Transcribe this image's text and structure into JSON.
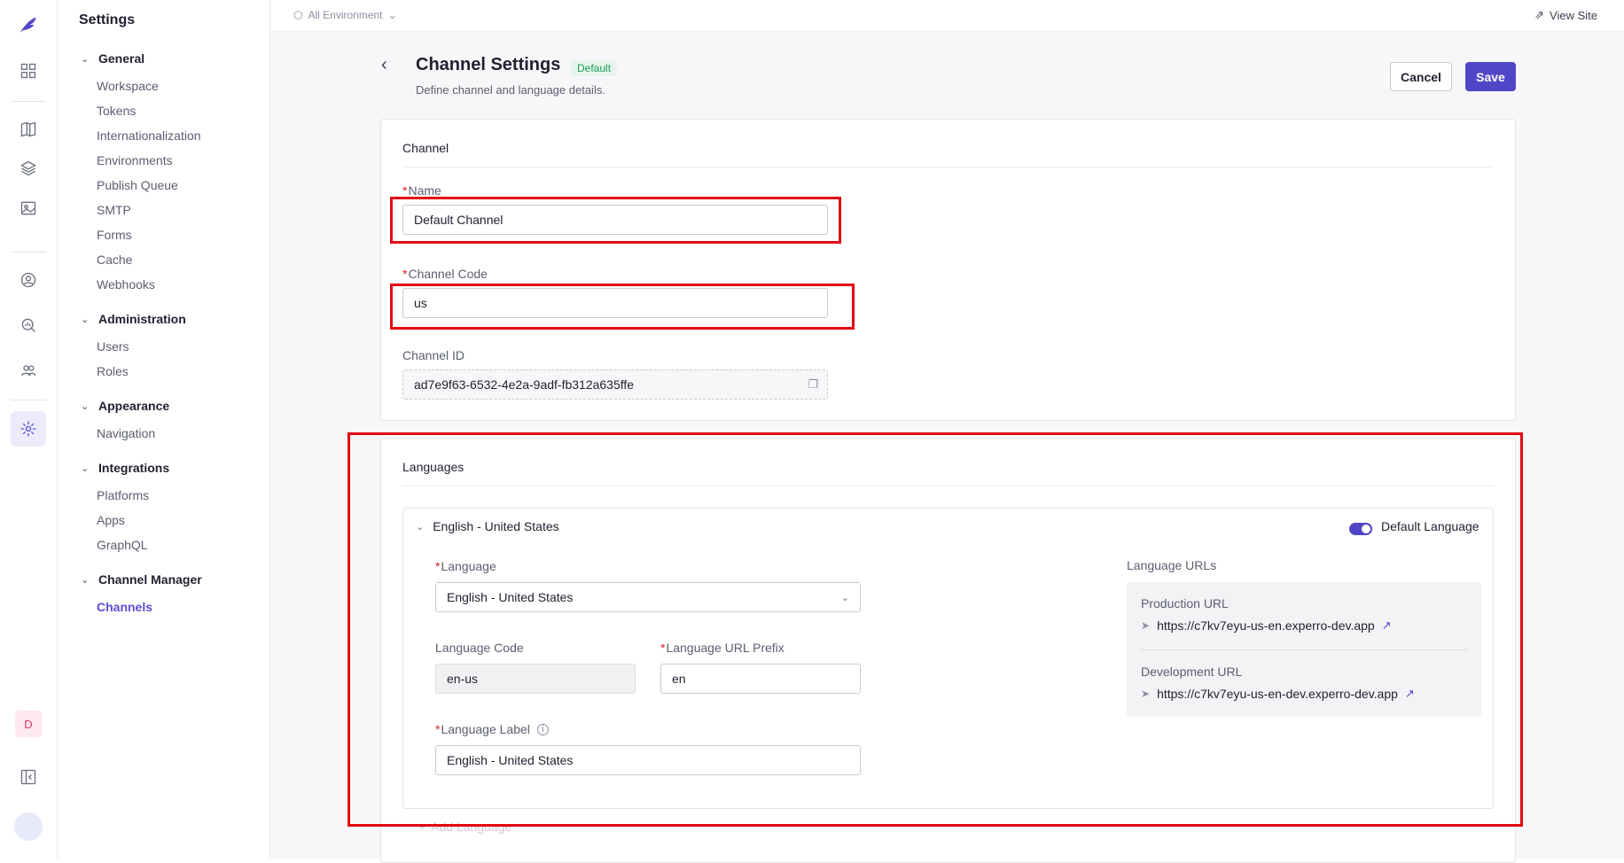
{
  "topbar": {
    "environment": "All Environment",
    "view_site": "View Site"
  },
  "settings_nav": {
    "title": "Settings",
    "groups": [
      {
        "label": "General",
        "items": [
          "Workspace",
          "Tokens",
          "Internationalization",
          "Environments",
          "Publish Queue",
          "SMTP",
          "Forms",
          "Cache",
          "Webhooks"
        ]
      },
      {
        "label": "Administration",
        "items": [
          "Users",
          "Roles"
        ]
      },
      {
        "label": "Appearance",
        "items": [
          "Navigation"
        ]
      },
      {
        "label": "Integrations",
        "items": [
          "Platforms",
          "Apps",
          "GraphQL"
        ]
      },
      {
        "label": "Channel Manager",
        "items": [
          "Channels"
        ]
      }
    ],
    "active_item": "Channels"
  },
  "rail": {
    "user_initial": "D",
    "icons": [
      "logo-icon",
      "dashboard-icon",
      "book-icon",
      "layers-icon",
      "image-icon",
      "user-circle-icon",
      "analytics-icon",
      "users-icon",
      "settings-icon",
      "collapse-icon"
    ]
  },
  "header": {
    "title": "Channel Settings",
    "badge": "Default",
    "subtitle": "Define channel and language details.",
    "cancel_label": "Cancel",
    "save_label": "Save"
  },
  "channel": {
    "section_title": "Channel",
    "name_label": "Name",
    "name_value": "Default Channel",
    "code_label": "Channel Code",
    "code_value": "us",
    "id_label": "Channel ID",
    "id_value": "ad7e9f63-6532-4e2a-9adf-fb312a635ffe"
  },
  "languages": {
    "section_title": "Languages",
    "entry_title": "English - United States",
    "default_toggle_label": "Default Language",
    "default_on": true,
    "language_label": "Language",
    "language_value": "English - United States",
    "code_label": "Language Code",
    "code_value": "en-us",
    "prefix_label": "Language URL Prefix",
    "prefix_value": "en",
    "display_label": "Language Label",
    "display_value": "English - United States",
    "urls_title": "Language URLs",
    "production_label": "Production URL",
    "production_url": "https://c7kv7eyu-us-en.experro-dev.app",
    "development_label": "Development URL",
    "development_url": "https://c7kv7eyu-us-en-dev.experro-dev.app",
    "add_language": "Add Language"
  },
  "colors": {
    "accent": "#4f46c7",
    "highlight": "#e30613",
    "badge_green": "#1f9d55"
  }
}
